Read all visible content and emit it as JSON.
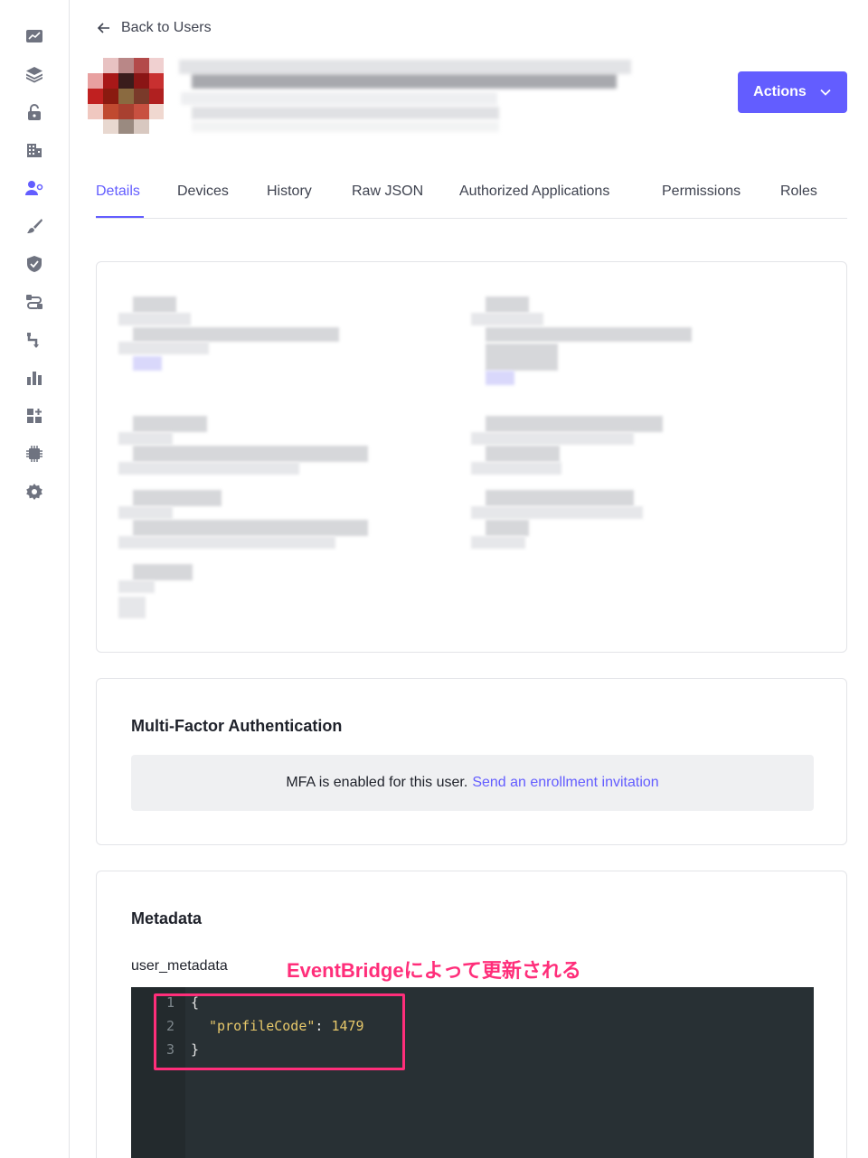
{
  "nav": {
    "back_label": "Back to Users"
  },
  "sidebar": {
    "items": [
      {
        "icon": "activity-icon"
      },
      {
        "icon": "layers-icon"
      },
      {
        "icon": "lock-icon"
      },
      {
        "icon": "organizations-icon"
      },
      {
        "icon": "user-management-icon"
      },
      {
        "icon": "branding-brush-icon"
      },
      {
        "icon": "security-shield-icon"
      },
      {
        "icon": "pipeline-icon"
      },
      {
        "icon": "actions-flow-icon"
      },
      {
        "icon": "monitoring-chart-icon"
      },
      {
        "icon": "marketplace-icon"
      },
      {
        "icon": "extensions-chip-icon"
      },
      {
        "icon": "settings-gear-icon"
      }
    ]
  },
  "header": {
    "actions_label": "Actions"
  },
  "tabs": [
    {
      "label": "Details"
    },
    {
      "label": "Devices"
    },
    {
      "label": "History"
    },
    {
      "label": "Raw JSON"
    },
    {
      "label": "Authorized Applications"
    },
    {
      "label": "Permissions"
    },
    {
      "label": "Roles"
    }
  ],
  "mfa": {
    "title": "Multi-Factor Authentication",
    "status_text": "MFA is enabled for this user.",
    "link_text": "Send an enrollment invitation"
  },
  "metadata": {
    "title": "Metadata",
    "user_metadata_label": "user_metadata",
    "annotation": "EventBridgeによって更新される",
    "code_lines": [
      {
        "num": "1",
        "text": "{"
      },
      {
        "num": "2",
        "key": "\"profileCode\"",
        "sep": ": ",
        "value": "1479"
      },
      {
        "num": "3",
        "text": "}"
      }
    ]
  },
  "colors": {
    "accent": "#635dff",
    "annotation": "#ff2e7a",
    "editor_bg": "#283034"
  }
}
